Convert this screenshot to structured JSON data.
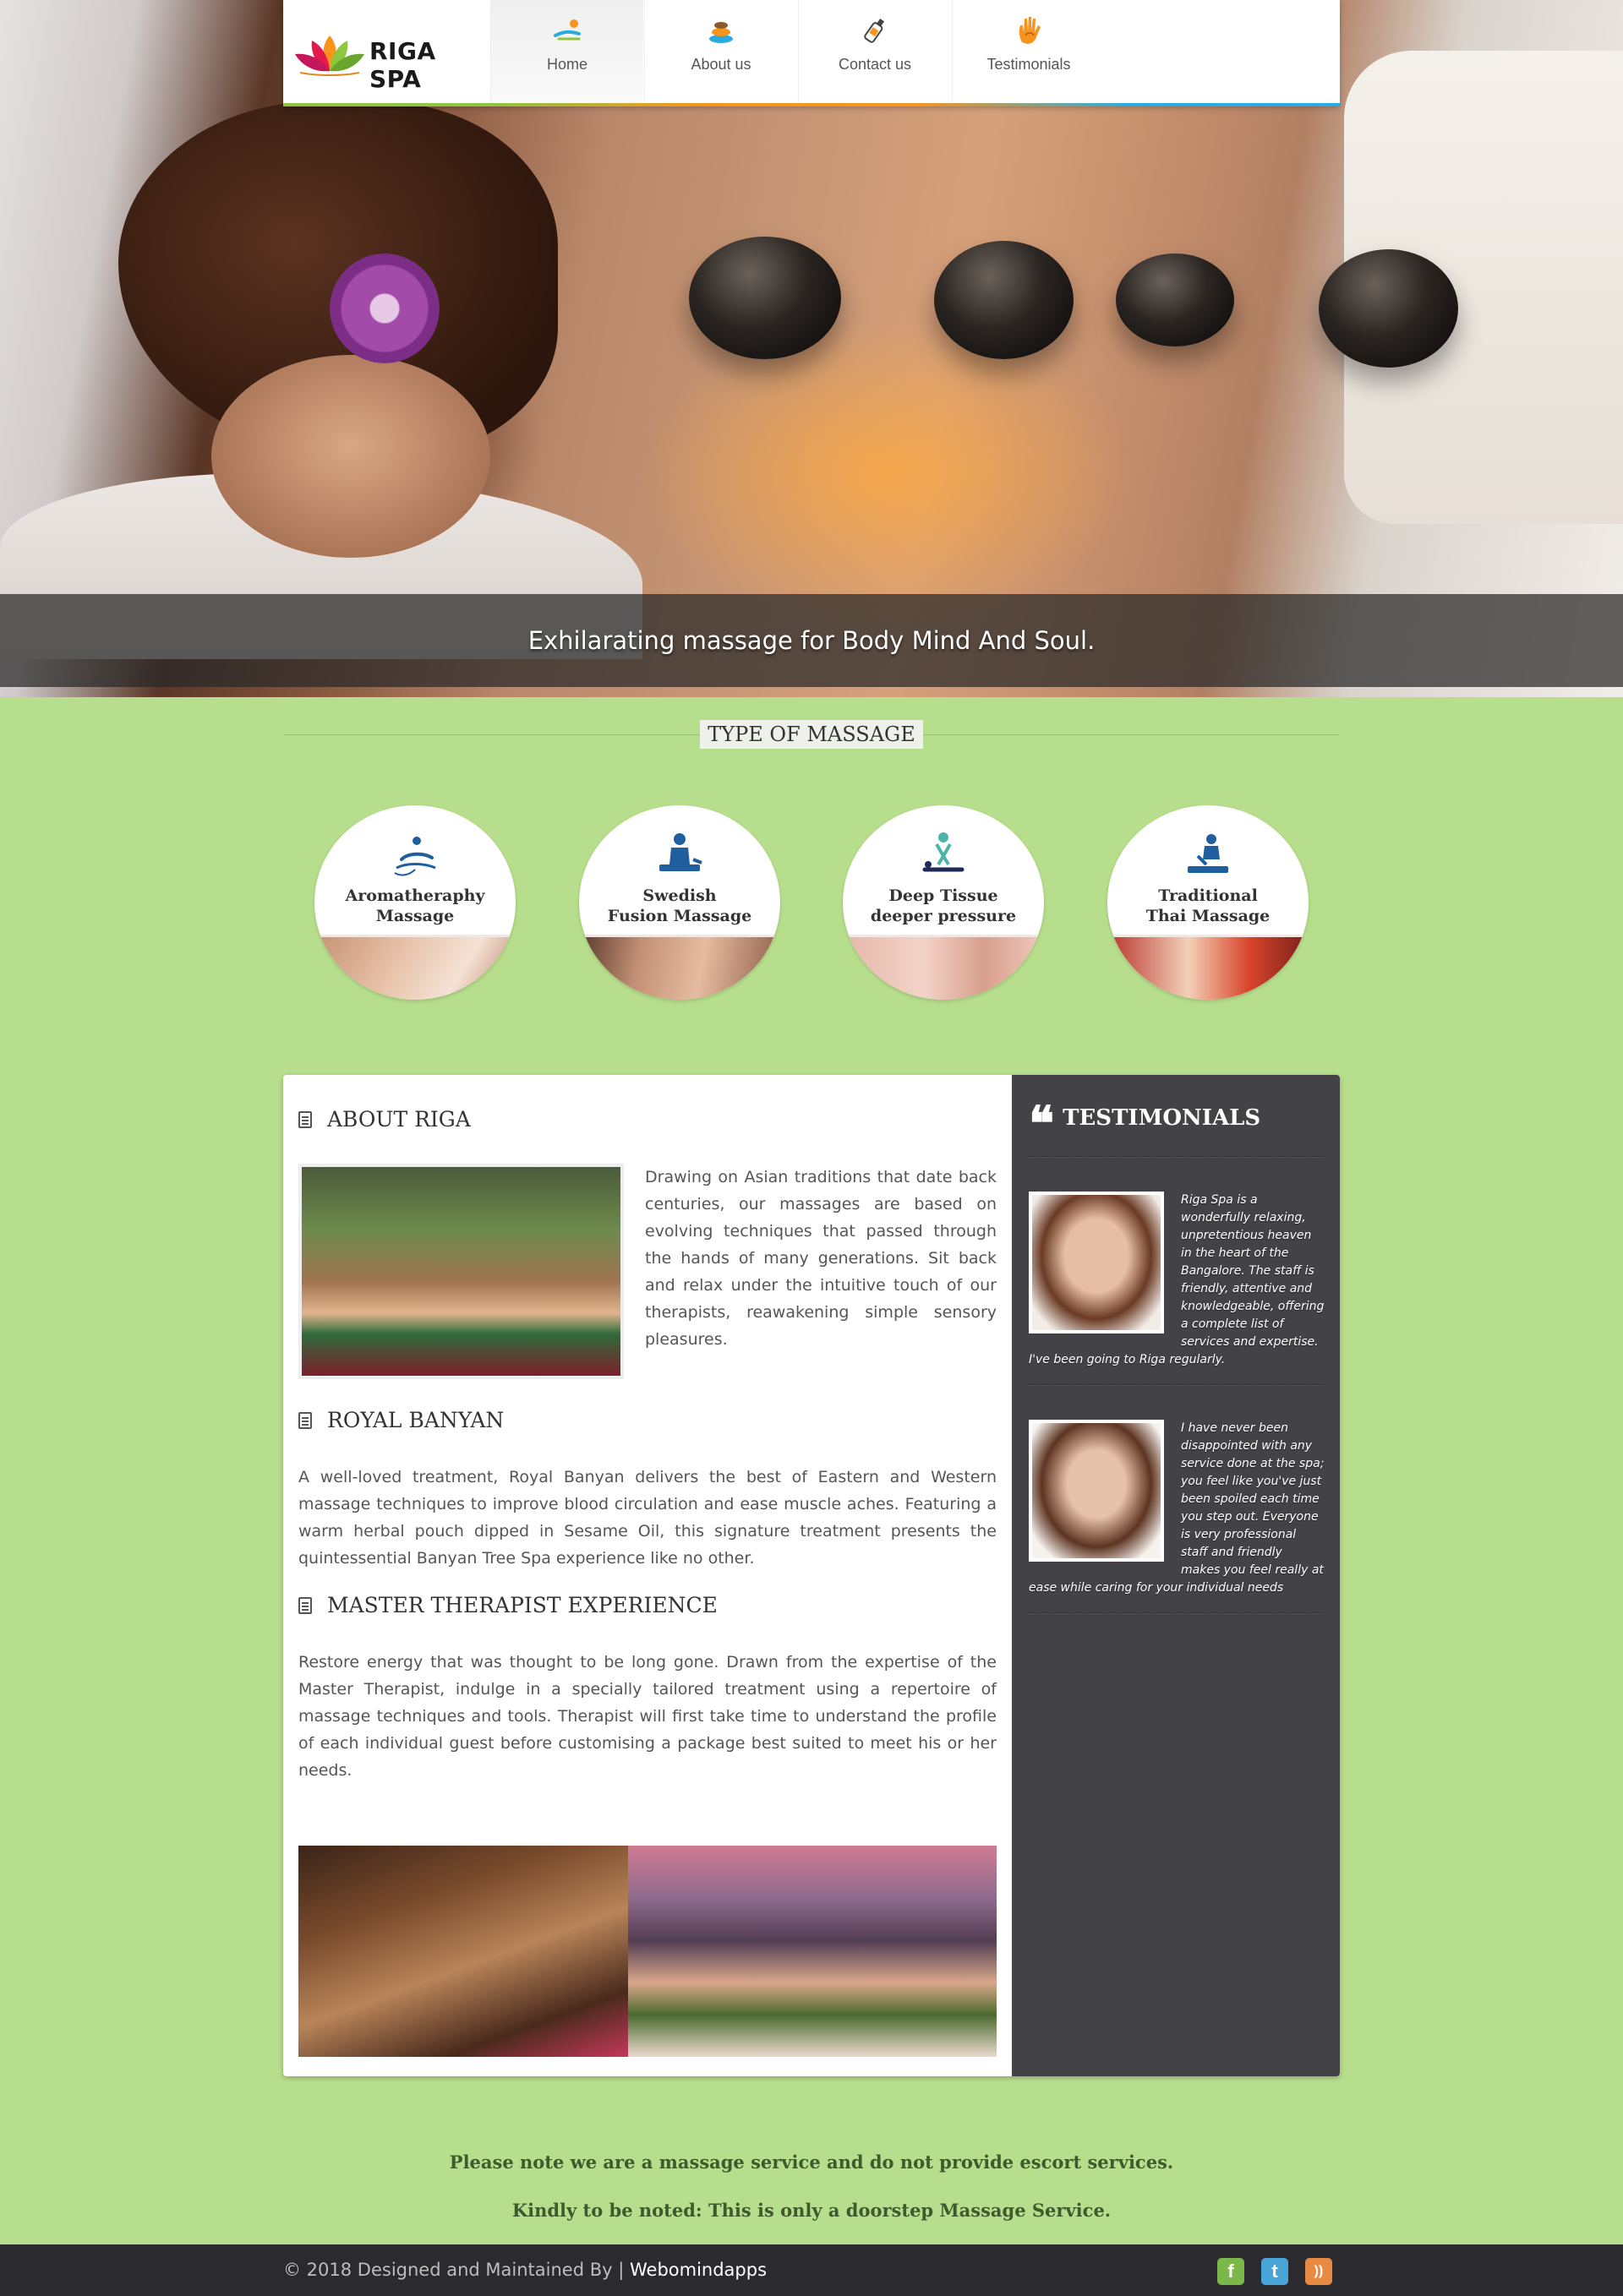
{
  "nav": {
    "logo_text": "RIGA SPA",
    "items": [
      {
        "label": "Home",
        "icon": "massage-icon",
        "active": true
      },
      {
        "label": "About us",
        "icon": "spa-stones-icon",
        "active": false
      },
      {
        "label": "Contact us",
        "icon": "oil-bottle-icon",
        "active": false
      },
      {
        "label": "Testimonials",
        "icon": "hand-icon",
        "active": false
      }
    ]
  },
  "hero": {
    "caption": "Exhilarating massage for Body Mind And Soul."
  },
  "massage_types": {
    "title": "TYPE OF MASSAGE",
    "items": [
      {
        "line1": "Aromatheraphy",
        "line2": "Massage",
        "icon": "aromatherapy-icon"
      },
      {
        "line1": "Swedish",
        "line2": "Fusion Massage",
        "icon": "swedish-massage-icon"
      },
      {
        "line1": "Deep Tissue",
        "line2": "deeper pressure",
        "icon": "deep-tissue-icon"
      },
      {
        "line1": "Traditional",
        "line2": "Thai Massage",
        "icon": "thai-massage-icon"
      }
    ]
  },
  "main": {
    "about": {
      "heading": "ABOUT RIGA",
      "text": "Drawing on Asian traditions that date back centuries, our massages are based on evolving techniques that passed through the hands of many generations. Sit back and relax under the intuitive touch of our therapists, reawakening simple sensory pleasures."
    },
    "royal": {
      "heading": "ROYAL BANYAN",
      "text": "A well-loved treatment, Royal Banyan delivers the best of Eastern and Western massage techniques to improve blood circulation and ease muscle aches. Featuring a warm herbal pouch dipped in Sesame Oil, this signature treatment presents the quintessential Banyan Tree Spa experience like no other."
    },
    "master": {
      "heading": "MASTER THERAPIST EXPERIENCE",
      "text": "Restore energy that was thought to be long gone. Drawn from the expertise of the Master Therapist, indulge in a specially tailored treatment using a repertoire of massage techniques and tools. Therapist will first take time to understand the profile of each individual guest before customising a package best suited to meet his or her needs."
    }
  },
  "testimonials": {
    "heading": "TESTIMONIALS",
    "items": [
      {
        "text": "Riga Spa is a wonderfully relaxing, unpretentious heaven in the heart of the Bangalore. The staff is friendly, attentive and knowledgeable, offering a complete list of services and expertise. I've been going to Riga regularly."
      },
      {
        "text": "I have never been disappointed with any service done at the spa; you feel like you've just been spoiled each time you step out. Everyone is very professional staff and friendly makes you feel really at ease while caring for your individual needs"
      }
    ]
  },
  "notes": {
    "line1": "Please note we are a massage service and do not provide escort services.",
    "line2": "Kindly to be noted: This is only a doorstep Massage Service."
  },
  "footer": {
    "copyright": "© 2018 Designed and Maintained By | ",
    "link": "Webomindapps",
    "social": [
      {
        "icon": "facebook-icon",
        "glyph": "f"
      },
      {
        "icon": "twitter-icon",
        "glyph": "t"
      },
      {
        "icon": "rss-icon",
        "glyph": "))"
      }
    ]
  },
  "colors": {
    "page_bg": "#b7de8c",
    "sidebar_bg": "#434347",
    "footer_bg": "#2b2b2f",
    "nav_stripe": [
      "#8dc63f",
      "#f7941d",
      "#29abe2"
    ]
  }
}
